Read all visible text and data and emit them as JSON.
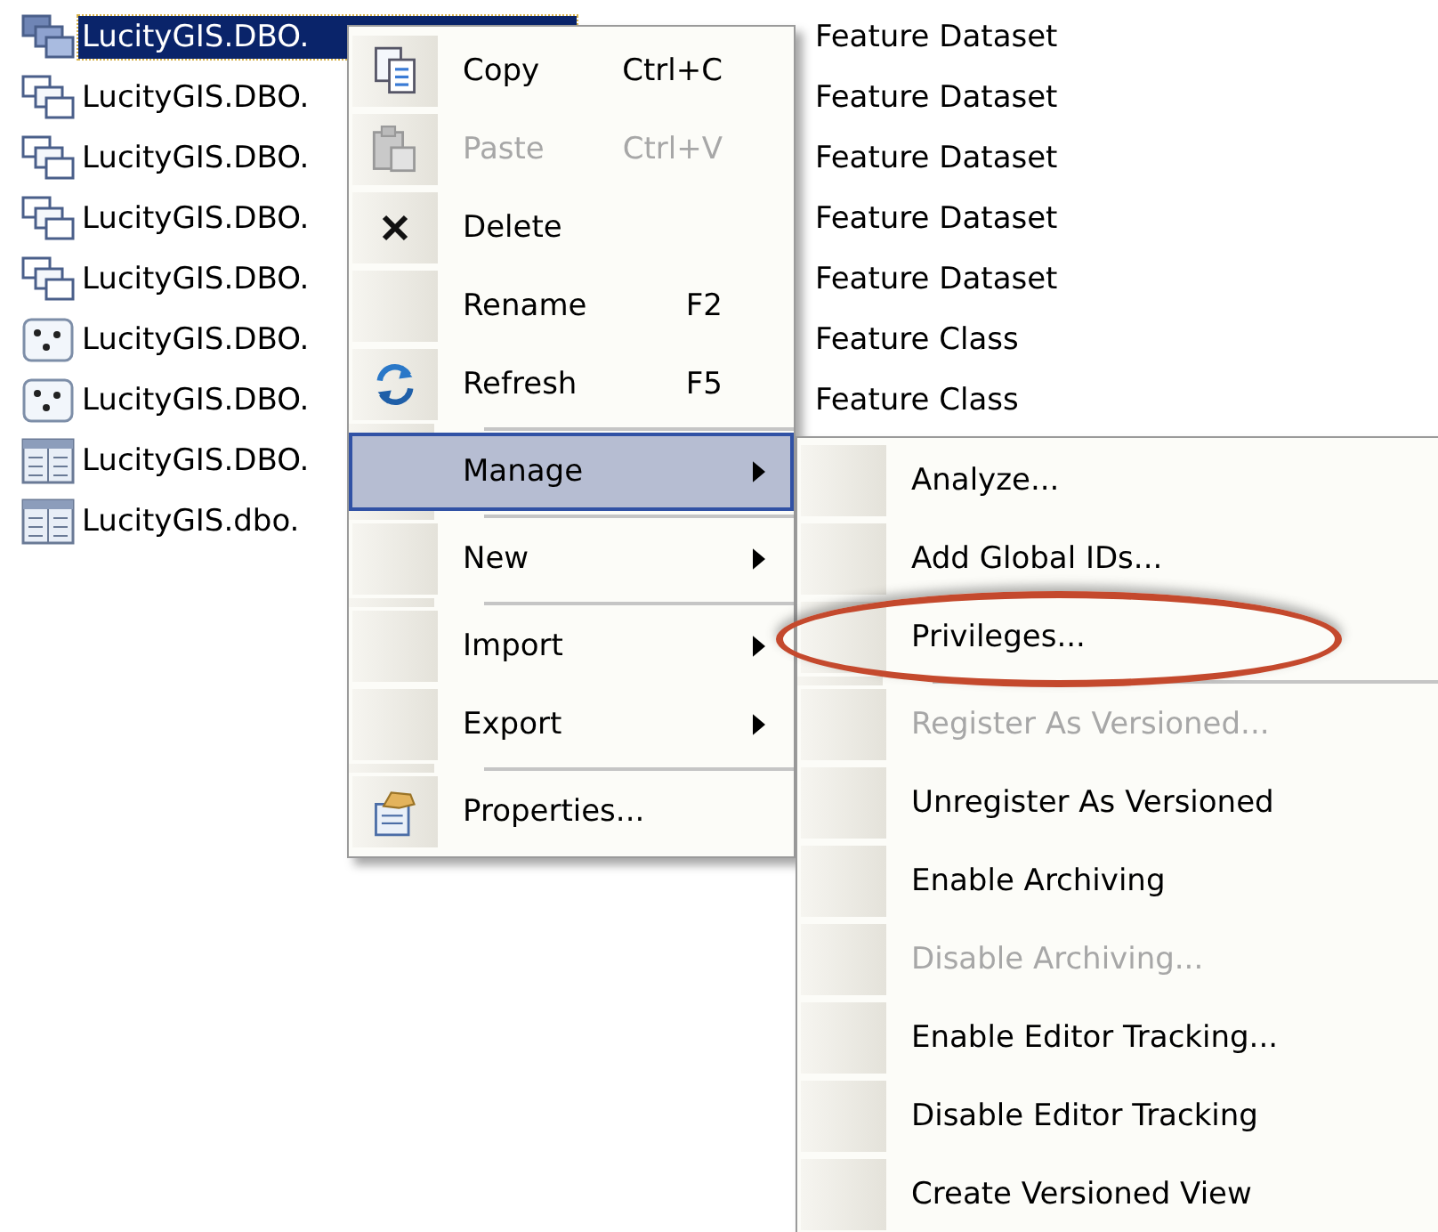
{
  "tree": {
    "rows": [
      {
        "kind": "dataset",
        "name": "LucityGIS.DBO.",
        "type": "Feature Dataset",
        "selected": true
      },
      {
        "kind": "dataset",
        "name": "LucityGIS.DBO.",
        "type": "Feature Dataset",
        "selected": false
      },
      {
        "kind": "dataset",
        "name": "LucityGIS.DBO.",
        "type": "Feature Dataset",
        "selected": false
      },
      {
        "kind": "dataset",
        "name": "LucityGIS.DBO.",
        "type": "Feature Dataset",
        "selected": false
      },
      {
        "kind": "dataset",
        "name": "LucityGIS.DBO.",
        "type": "Feature Dataset",
        "selected": false
      },
      {
        "kind": "points",
        "name": "LucityGIS.DBO.",
        "type": "Feature Class",
        "selected": false
      },
      {
        "kind": "points",
        "name": "LucityGIS.DBO.",
        "type": "Feature Class",
        "selected": false
      },
      {
        "kind": "table",
        "name": "LucityGIS.DBO.",
        "selected": false
      },
      {
        "kind": "table",
        "name": "LucityGIS.dbo.",
        "selected": false
      }
    ]
  },
  "context_menu": {
    "items": [
      {
        "kind": "copy",
        "label": "Copy",
        "shortcut": "Ctrl+C",
        "disabled": false,
        "selected": false
      },
      {
        "kind": "paste",
        "label": "Paste",
        "shortcut": "Ctrl+V",
        "disabled": true,
        "selected": false
      },
      {
        "kind": "delete",
        "label": "Delete",
        "disabled": false,
        "selected": false
      },
      {
        "kind": "plain",
        "label": "Rename",
        "shortcut": "F2",
        "disabled": false,
        "selected": false
      },
      {
        "kind": "refresh",
        "label": "Refresh",
        "shortcut": "F5",
        "disabled": false,
        "selected": false
      },
      {
        "kind": "separator"
      },
      {
        "kind": "submenu",
        "label": "Manage",
        "disabled": false,
        "selected": true
      },
      {
        "kind": "separator"
      },
      {
        "kind": "submenu",
        "label": "New",
        "disabled": false,
        "selected": false
      },
      {
        "kind": "separator"
      },
      {
        "kind": "submenu",
        "label": "Import",
        "disabled": false,
        "selected": false
      },
      {
        "kind": "submenu",
        "label": "Export",
        "disabled": false,
        "selected": false
      },
      {
        "kind": "separator"
      },
      {
        "kind": "properties",
        "label": "Properties...",
        "disabled": false,
        "selected": false
      }
    ]
  },
  "submenu": {
    "items": [
      {
        "kind": "item",
        "label": "Analyze...",
        "disabled": false,
        "circled": false
      },
      {
        "kind": "item",
        "label": "Add Global IDs...",
        "disabled": false,
        "circled": false
      },
      {
        "kind": "item",
        "label": "Privileges...",
        "disabled": false,
        "circled": true
      },
      {
        "kind": "separator"
      },
      {
        "kind": "item",
        "label": "Register As Versioned...",
        "disabled": true,
        "circled": false
      },
      {
        "kind": "item",
        "label": "Unregister As Versioned",
        "disabled": false,
        "circled": false
      },
      {
        "kind": "item",
        "label": "Enable Archiving",
        "disabled": false,
        "circled": false
      },
      {
        "kind": "item",
        "label": "Disable Archiving...",
        "disabled": true,
        "circled": false
      },
      {
        "kind": "item",
        "label": "Enable Editor Tracking...",
        "disabled": false,
        "circled": false
      },
      {
        "kind": "item",
        "label": "Disable Editor Tracking",
        "disabled": false,
        "circled": false
      },
      {
        "kind": "item",
        "label": "Create Versioned View",
        "disabled": false,
        "circled": false
      }
    ]
  }
}
